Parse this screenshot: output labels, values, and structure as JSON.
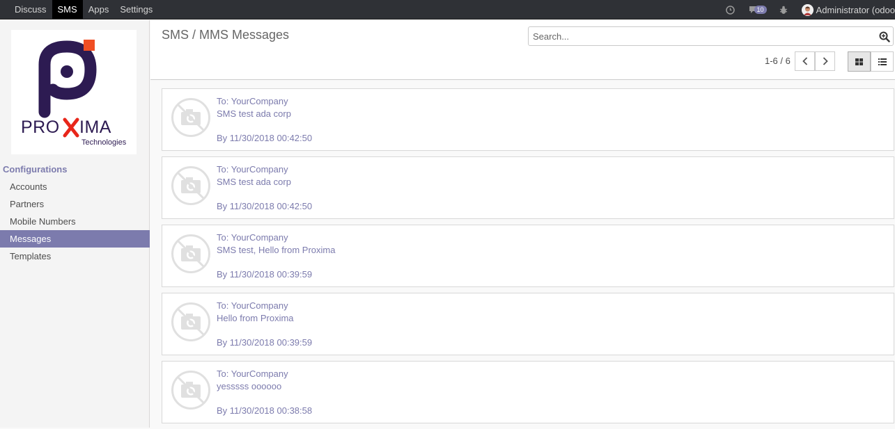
{
  "topbar": {
    "menu": [
      "Discuss",
      "SMS",
      "Apps",
      "Settings"
    ],
    "active_menu": "SMS",
    "notification_count": "10",
    "user_label": "Administrator (odoo"
  },
  "sidebar": {
    "logo": {
      "brand": "PROXIMA",
      "tagline": "Technologies"
    },
    "section": "Configurations",
    "items": [
      "Accounts",
      "Partners",
      "Mobile Numbers",
      "Messages",
      "Templates"
    ],
    "active_item": "Messages"
  },
  "control": {
    "breadcrumb": "SMS / MMS Messages",
    "search_placeholder": "Search...",
    "pager": "1-6 / 6"
  },
  "messages": [
    {
      "to": "To: YourCompany",
      "body": "SMS test ada corp",
      "date": "By 11/30/2018 00:42:50"
    },
    {
      "to": "To: YourCompany",
      "body": "SMS test ada corp",
      "date": "By 11/30/2018 00:42:50"
    },
    {
      "to": "To: YourCompany",
      "body": "SMS test, Hello from Proxima",
      "date": "By 11/30/2018 00:39:59"
    },
    {
      "to": "To: YourCompany",
      "body": "Hello from Proxima",
      "date": "By 11/30/2018 00:39:59"
    },
    {
      "to": "To: YourCompany",
      "body": "yesssss oooooo",
      "date": "By 11/30/2018 00:38:58"
    }
  ],
  "colors": {
    "accent": "#7c7bad",
    "navbar": "#2f3136",
    "logo_purple": "#2d1b52",
    "logo_orange": "#f04e23"
  }
}
